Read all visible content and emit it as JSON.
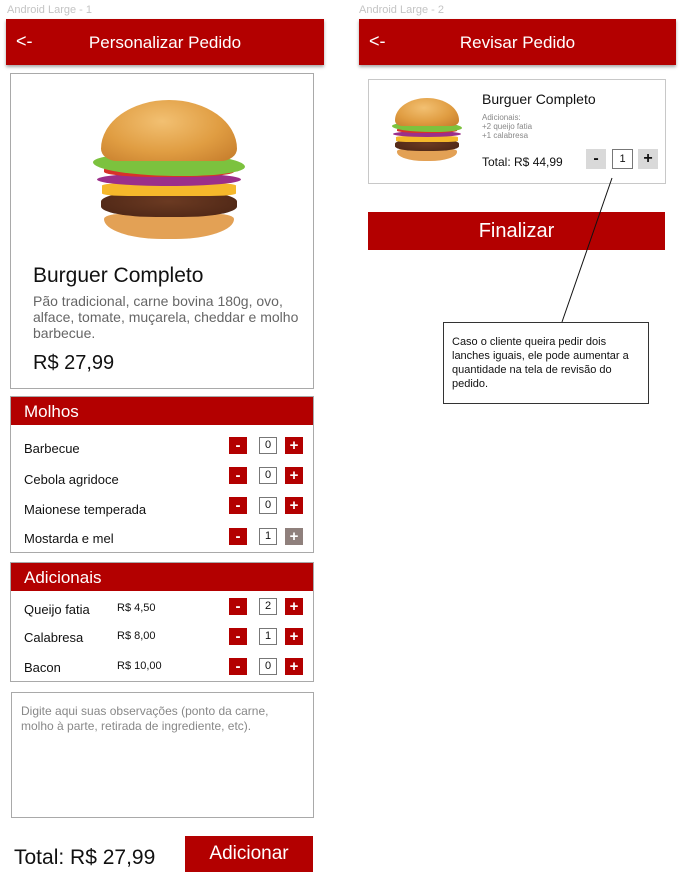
{
  "screen1": {
    "frame_label": "Android Large - 1",
    "back_label": "<-",
    "title": "Personalizar Pedido",
    "product": {
      "name": "Burguer Completo",
      "description": "Pão tradicional, carne bovina 180g, ovo, alface, tomate, muçarela, cheddar e molho barbecue.",
      "price": "R$ 27,99"
    },
    "molhos": {
      "title": "Molhos",
      "items": [
        {
          "label": "Barbecue",
          "qty": "0"
        },
        {
          "label": "Cebola agridoce",
          "qty": "0"
        },
        {
          "label": "Maionese temperada",
          "qty": "0"
        },
        {
          "label": "Mostarda e mel",
          "qty": "1"
        }
      ]
    },
    "adicionais": {
      "title": "Adicionais",
      "items": [
        {
          "label": "Queijo fatia",
          "price": "R$ 4,50",
          "qty": "2"
        },
        {
          "label": "Calabresa",
          "price": "R$ 8,00",
          "qty": "1"
        },
        {
          "label": "Bacon",
          "price": "R$ 10,00",
          "qty": "0"
        }
      ]
    },
    "minus": "-",
    "plus": "+",
    "observations_placeholder": "Digite aqui suas observações (ponto da carne, molho à parte, retirada de ingrediente, etc).",
    "total": "Total: R$ 27,99",
    "add_button": "Adicionar"
  },
  "screen2": {
    "frame_label": "Android Large - 2",
    "back_label": "<-",
    "title": "Revisar Pedido",
    "item": {
      "name": "Burguer Completo",
      "extras_title": "Adicionais:",
      "extras": [
        "+2 queijo fatia",
        "+1 calabresa"
      ],
      "total": "Total: R$ 44,99",
      "qty": "1"
    },
    "minus": "-",
    "plus": "+",
    "finalize_button": "Finalizar",
    "note": "Caso o cliente queira pedir dois lanches iguais, ele pode aumentar a quantidade na tela de revisão do pedido."
  },
  "colors": {
    "brand_red": "#b30000",
    "disabled_plus": "#8f807c"
  }
}
